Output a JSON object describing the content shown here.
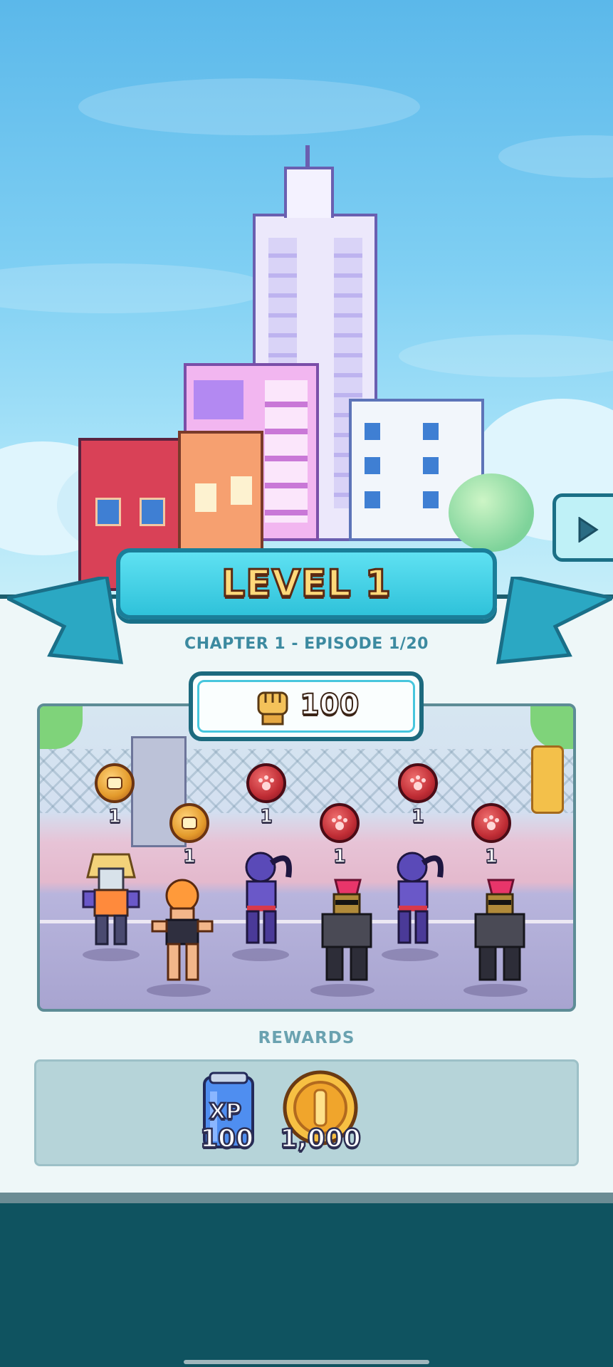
{
  "level": {
    "title": "LEVEL 1"
  },
  "chapter": {
    "text": "CHAPTER 1 - EPISODE 1/20"
  },
  "power": {
    "icon": "fist-icon",
    "value": "100"
  },
  "enemies": [
    {
      "icon": "fist-medal-icon",
      "type": "gold",
      "count": "1"
    },
    {
      "icon": "fist-medal-icon",
      "type": "gold",
      "count": "1"
    },
    {
      "icon": "paw-medal-icon",
      "type": "red",
      "count": "1"
    },
    {
      "icon": "paw-medal-icon",
      "type": "red",
      "count": "1"
    },
    {
      "icon": "paw-medal-icon",
      "type": "red",
      "count": "1"
    },
    {
      "icon": "paw-medal-icon",
      "type": "red",
      "count": "1"
    }
  ],
  "rewards": {
    "title": "REWARDS",
    "items": [
      {
        "icon": "xp-can-icon",
        "label": "XP",
        "value": "100"
      },
      {
        "icon": "gold-coin-icon",
        "value": "1,000"
      }
    ]
  },
  "next_button": {
    "icon": "play-arrow-icon"
  },
  "colors": {
    "accent": "#2fc2da",
    "panel": "#eef7f8",
    "dark_teal": "#0f5360"
  }
}
